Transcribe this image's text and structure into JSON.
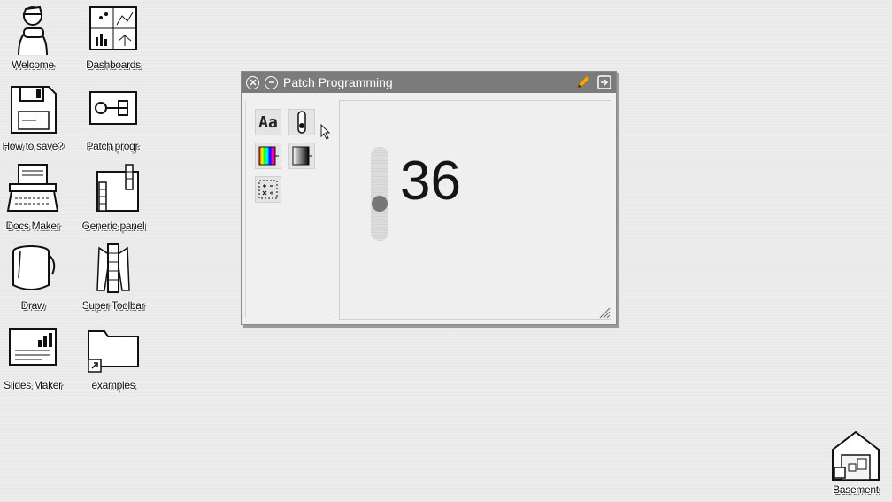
{
  "desktop": {
    "icons": [
      {
        "label": "Welcome",
        "icon": "person-icon"
      },
      {
        "label": "Dashboards",
        "icon": "dashboard-icon"
      },
      {
        "label": "How to save?",
        "icon": "floppy-disk-icon"
      },
      {
        "label": "Patch progr.",
        "icon": "patch-icon"
      },
      {
        "label": "Docs Maker",
        "icon": "typewriter-icon"
      },
      {
        "label": "Generic panel",
        "icon": "panel-icon"
      },
      {
        "label": "Draw",
        "icon": "paint-bucket-icon"
      },
      {
        "label": "Super Toolbar",
        "icon": "toolbar-icon"
      },
      {
        "label": "Slides Maker",
        "icon": "slides-icon"
      },
      {
        "label": "examples",
        "icon": "folder-shortcut-icon"
      },
      {
        "label": "Basement",
        "icon": "house-icon"
      }
    ]
  },
  "window": {
    "title": "Patch Programming",
    "tools": [
      "text-tool-icon",
      "slider-tool-icon",
      "color-picker-icon",
      "gradient-icon",
      "calculator-icon"
    ],
    "text_tool_label": "Aa",
    "slider": {
      "level_fraction": 0.38
    },
    "display_value": "36"
  },
  "colors": {
    "titlebar": "#7b7b7b",
    "edit_pencil": "#f5a623",
    "background": "#ececec"
  }
}
